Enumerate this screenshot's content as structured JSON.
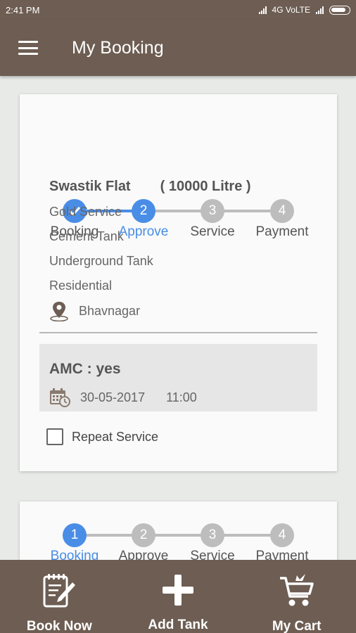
{
  "status_bar": {
    "time": "2:41 PM",
    "network": "4G VoLTE"
  },
  "app_bar": {
    "title": "My Booking"
  },
  "steps": [
    "Booking",
    "Approve",
    "Service",
    "Payment"
  ],
  "colors": {
    "primary": "#6d5d52",
    "active": "#4a8de6",
    "inactive": "#bdbdbd"
  },
  "bookings": [
    {
      "current_step": 2,
      "step_numbers": [
        "✓",
        "2",
        "3",
        "4"
      ],
      "name": "Swastik Flat",
      "capacity": "( 10000 Litre )",
      "service": "Gold Service",
      "tank_type": "Cement Tank",
      "tank_location": "Underground Tank",
      "category": "Residential",
      "city": "Bhavnagar",
      "amc": "AMC :  yes",
      "date": "30-05-2017",
      "time": "11:00",
      "repeat_label": "Repeat Service",
      "repeat_checked": false
    },
    {
      "current_step": 1,
      "step_numbers": [
        "1",
        "2",
        "3",
        "4"
      ]
    }
  ],
  "bottom_nav": [
    {
      "label": "Book Now",
      "icon": "notepad-pencil-icon"
    },
    {
      "label": "Add Tank",
      "icon": "plus-icon"
    },
    {
      "label": "My Cart",
      "icon": "cart-icon"
    }
  ]
}
